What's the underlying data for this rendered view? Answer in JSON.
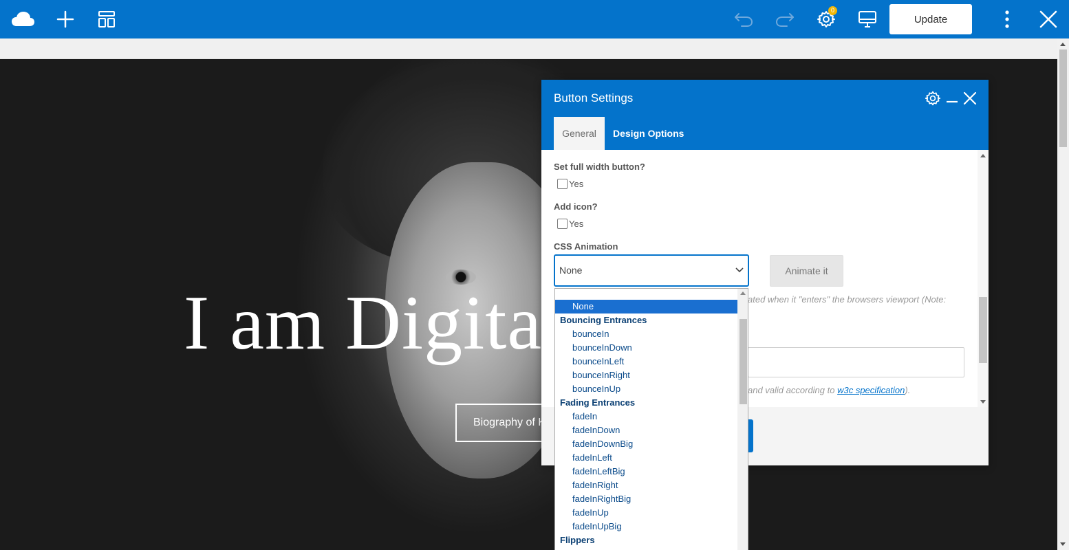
{
  "toolbar": {
    "logo_icon": "cloud-logo-icon",
    "add_icon": "plus-icon",
    "templates_icon": "layout-templates-icon",
    "undo_icon": "undo-icon",
    "redo_icon": "redo-icon",
    "settings_icon": "gear-icon",
    "settings_badge": "0",
    "responsive_icon": "desktop-monitor-icon",
    "update_label": "Update",
    "more_icon": "vertical-dots-icon",
    "close_icon": "close-icon",
    "colors": {
      "bar": "#0473cb",
      "badge": "#f2b705"
    }
  },
  "hero": {
    "title": "I am Digita",
    "button_label": "Biography of K"
  },
  "panel": {
    "title": "Button Settings",
    "tabs": [
      {
        "label": "General",
        "active": true
      },
      {
        "label": "Design Options",
        "active": false
      }
    ],
    "fields": {
      "full_width": {
        "label": "Set full width button?",
        "option": "Yes"
      },
      "add_icon": {
        "label": "Add icon?",
        "option": "Yes"
      },
      "css_animation": {
        "label": "CSS Animation",
        "value": "None",
        "animate_label": "Animate it"
      }
    },
    "help_animation": "ated when it \"enters\" the browsers viewport (Note:",
    "help_id_prefix": "and valid according to ",
    "help_id_link": "w3c specification",
    "help_id_suffix": ")."
  },
  "dropdown": {
    "items": [
      {
        "type": "option",
        "label": "None",
        "selected": true
      },
      {
        "type": "group",
        "label": "Bouncing Entrances"
      },
      {
        "type": "option",
        "label": "bounceIn"
      },
      {
        "type": "option",
        "label": "bounceInDown"
      },
      {
        "type": "option",
        "label": "bounceInLeft"
      },
      {
        "type": "option",
        "label": "bounceInRight"
      },
      {
        "type": "option",
        "label": "bounceInUp"
      },
      {
        "type": "group",
        "label": "Fading Entrances"
      },
      {
        "type": "option",
        "label": "fadeIn"
      },
      {
        "type": "option",
        "label": "fadeInDown"
      },
      {
        "type": "option",
        "label": "fadeInDownBig"
      },
      {
        "type": "option",
        "label": "fadeInLeft"
      },
      {
        "type": "option",
        "label": "fadeInLeftBig"
      },
      {
        "type": "option",
        "label": "fadeInRight"
      },
      {
        "type": "option",
        "label": "fadeInRightBig"
      },
      {
        "type": "option",
        "label": "fadeInUp"
      },
      {
        "type": "option",
        "label": "fadeInUpBig"
      },
      {
        "type": "group",
        "label": "Flippers"
      }
    ]
  }
}
